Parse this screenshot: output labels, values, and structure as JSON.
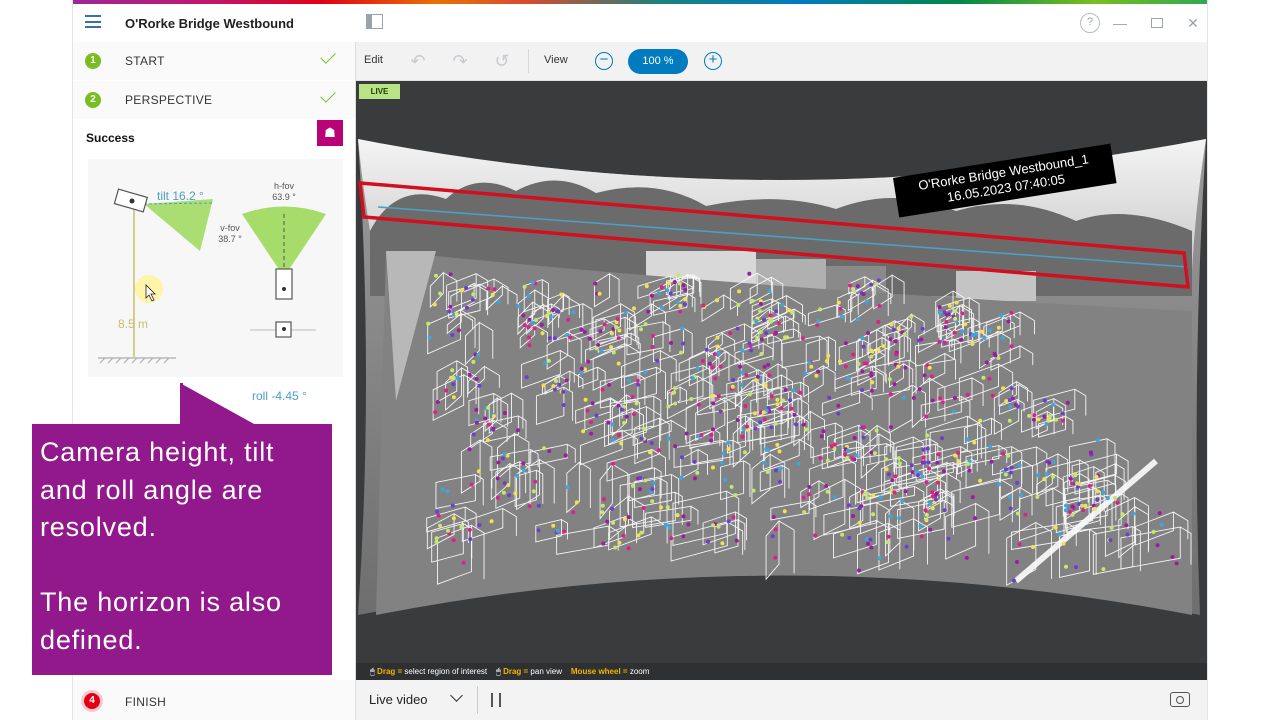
{
  "window": {
    "title": "O'Rorke Bridge Westbound",
    "help_glyph": "?",
    "minimize_glyph": "—",
    "close_glyph": "✕"
  },
  "sidebar": {
    "steps": [
      {
        "number": "1",
        "label": "START"
      },
      {
        "number": "2",
        "label": "PERSPECTIVE"
      }
    ],
    "status": "Success",
    "finish": {
      "number": "4",
      "label": "FINISH"
    },
    "diagram": {
      "tilt": "tilt 16.2 °",
      "hfov_label": "h-fov",
      "hfov_value": "63.9 °",
      "vfov_label": "v-fov",
      "vfov_value": "38.7 °",
      "height": "8.5 m",
      "roll": "roll -4.45 °"
    }
  },
  "callout": {
    "line1": "Camera height, tilt and roll angle are resolved.",
    "line2": "The horizon is also defined."
  },
  "toolbar": {
    "edit_label": "Edit",
    "view_label": "View",
    "zoom_value": "100 %",
    "zoom_out": "−",
    "zoom_in": "+"
  },
  "video": {
    "live_badge": "LIVE",
    "camera_name": "O'Rorke Bridge Westbound_1",
    "timestamp": "16.05.2023 07:40:05"
  },
  "hints": {
    "drag1_key": "Drag =",
    "drag1_text": "select region of interest",
    "drag2_key": "Drag =",
    "drag2_text": "pan view",
    "wheel_key": "Mouse wheel =",
    "wheel_text": "zoom"
  },
  "bottom_bar": {
    "source": "Live video"
  },
  "colors": {
    "accent_blue": "#007bc0",
    "success_green": "#78be20",
    "callout_purple": "#91198c",
    "horizon_red": "#d0101e",
    "horizon_blue": "#4a9fc4"
  }
}
